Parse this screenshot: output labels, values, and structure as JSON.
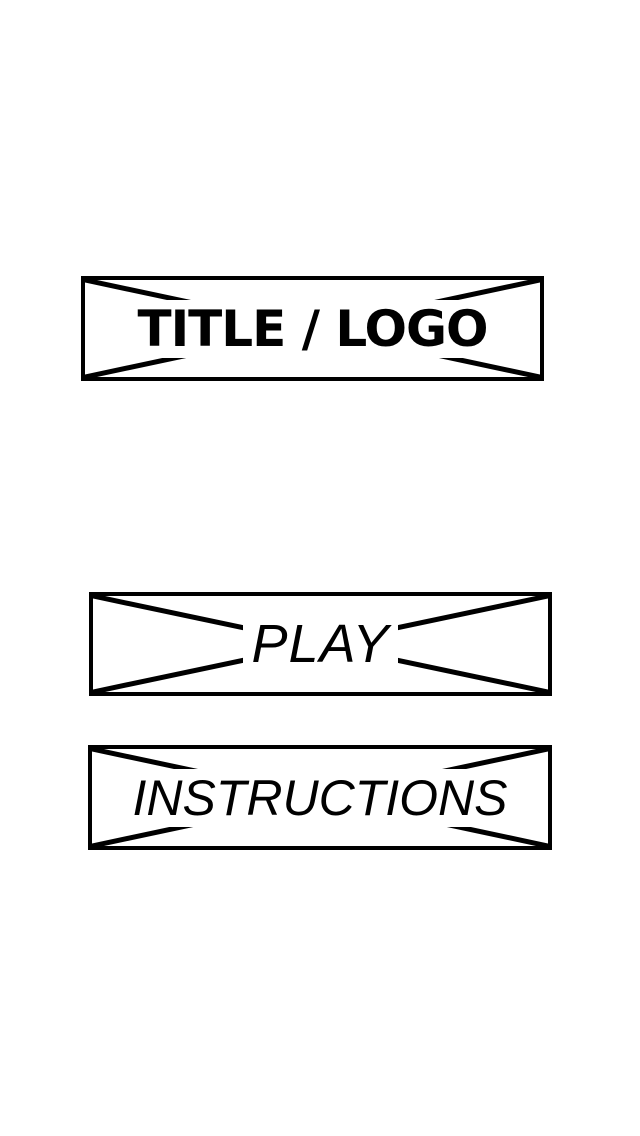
{
  "colors": {
    "background": "#ffffff",
    "stroke": "#000000",
    "text": "#000000"
  },
  "logo": {
    "text": "TITLE / LOGO"
  },
  "menu": {
    "play_label": "PLAY",
    "instructions_label": "INSTRUCTIONS"
  }
}
